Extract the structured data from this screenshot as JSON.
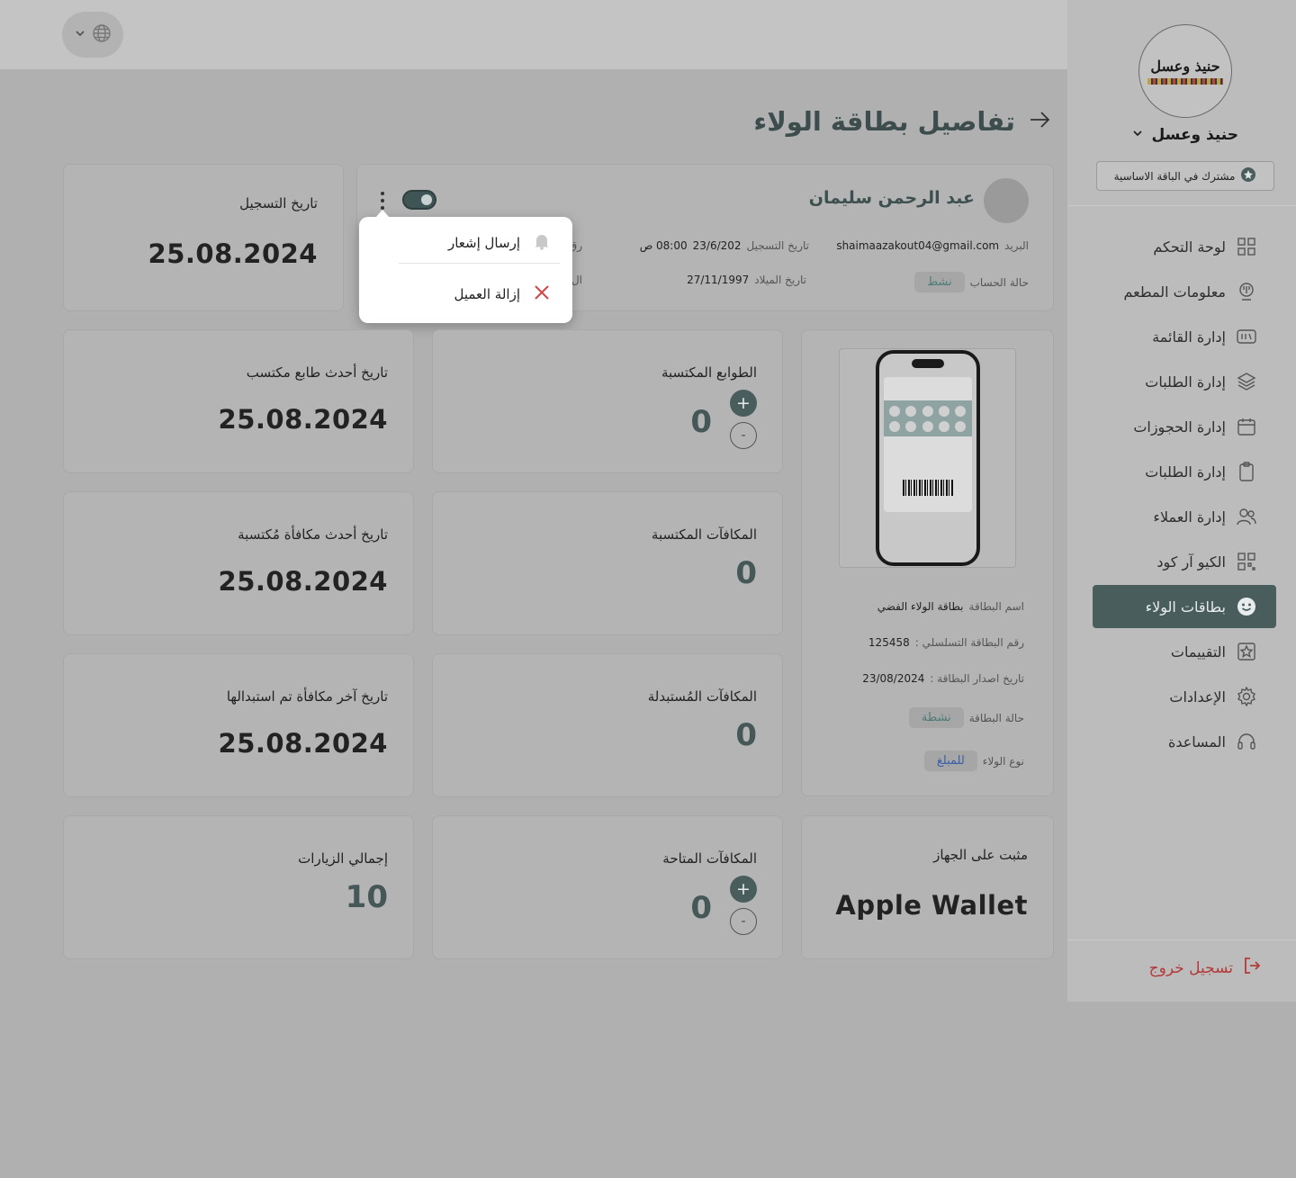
{
  "header": {
    "lang_button": {
      "globe_icon": "globe-icon",
      "chevron_icon": "chevron-down-icon"
    }
  },
  "sidebar": {
    "logo_text": "حنيذ وعسل",
    "brand_name": "حنيذ وعسل",
    "plan_badge": "مشترك في الباقة الاساسية",
    "items": [
      {
        "label": "لوحة التحكم",
        "icon": "dashboard-grid-icon"
      },
      {
        "label": "معلومات المطعم",
        "icon": "restaurant-icon"
      },
      {
        "label": "إدارة القائمة",
        "icon": "menu-icon"
      },
      {
        "label": "إدارة الطلبات",
        "icon": "layers-icon"
      },
      {
        "label": "إدارة الحجوزات",
        "icon": "calendar-icon"
      },
      {
        "label": "إدارة الطلبات",
        "icon": "clipboard-icon"
      },
      {
        "label": "إدارة العملاء",
        "icon": "users-icon"
      },
      {
        "label": "الكيو آر كود",
        "icon": "qr-code-icon"
      },
      {
        "label": "بطاقات الولاء",
        "icon": "smile-icon",
        "active": true
      },
      {
        "label": "التقييمات",
        "icon": "star-icon"
      },
      {
        "label": "الإعدادات",
        "icon": "gear-icon"
      },
      {
        "label": "المساعدة",
        "icon": "headset-icon"
      }
    ],
    "logout_label": "تسجيل خروج"
  },
  "page": {
    "title": "تفاصيل بطاقة الولاء"
  },
  "profile": {
    "name": "عبد الرحمن سليمان",
    "email_label": "البريد",
    "email": "shaimaazakout04@gmail.com",
    "reg_label": "تاريخ التسجيل",
    "reg_date": "23/6/202",
    "reg_time": "08:00 ص",
    "status_label": "حالة الحساب",
    "status": "نشط",
    "birth_label": "تاريخ الميلاد",
    "birth_date": "27/11/1997",
    "partial_1": "رق",
    "partial_2": "ال"
  },
  "popup": {
    "send_notification": "إرسال إشعار",
    "remove_customer": "إزالة العميل"
  },
  "registration_card": {
    "label": "تاريخ التسجيل",
    "value": "25.08.2024"
  },
  "loyalty_card": {
    "name_label": "اسم البطاقة",
    "name": "بطاقة الولاء الفضي",
    "serial_label": "رقم البطاقة التسلسلي :",
    "serial": "125458",
    "issue_label": "تاريخ اصدار البطاقة :",
    "issue_date": "23/08/2024",
    "status_label": "حالة البطاقة",
    "status": "نشطة",
    "type_label": "نوع الولاء",
    "type": "للمبلغ"
  },
  "stats": {
    "stamps_earned_label": "الطوابع المكتسبة",
    "stamps_earned": "0",
    "last_stamp_label": "تاريخ أحدث طابع مكتسب",
    "last_stamp": "25.08.2024",
    "rewards_earned_label": "المكافآت المكتسبة",
    "rewards_earned": "0",
    "last_reward_label": "تاريخ أحدث مكافأة مُكتسبة",
    "last_reward": "25.08.2024",
    "rewards_redeemed_label": "المكافآت المُستبدلة",
    "rewards_redeemed": "0",
    "last_redeemed_label": "تاريخ آخر مكافأة تم استبدالها",
    "last_redeemed": "25.08.2024",
    "installed_label": "مثبت على الجهاز",
    "installed": "Apple Wallet",
    "rewards_available_label": "المكافآت المتاحة",
    "rewards_available": "0",
    "total_visits_label": "إجمالي الزيارات",
    "total_visits": "10"
  },
  "steppers": {
    "plus": "+",
    "minus": "-"
  }
}
